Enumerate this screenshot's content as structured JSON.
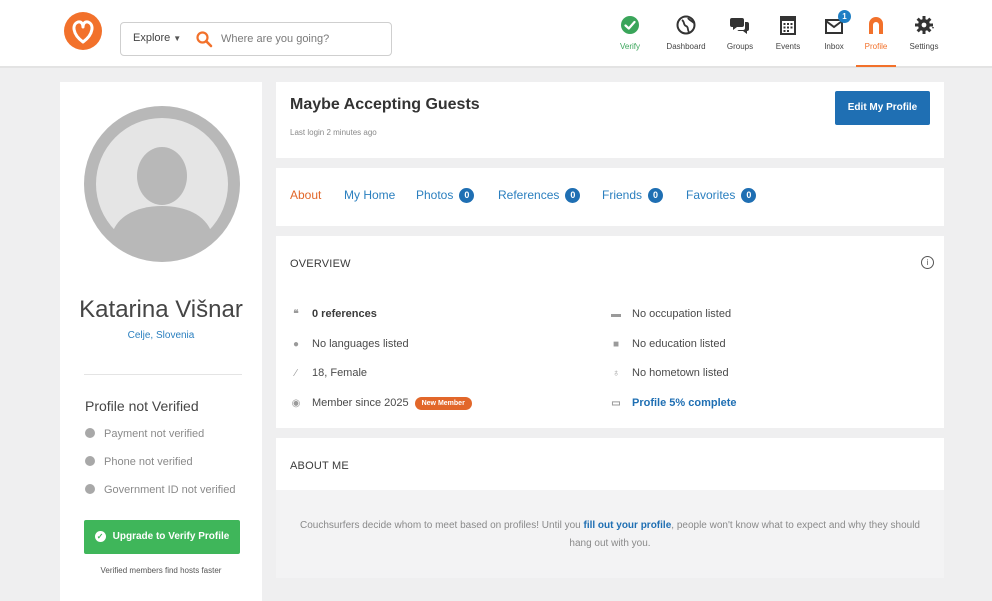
{
  "colors": {
    "brand": "#f2712b",
    "link": "#1f6fb3",
    "verify_green": "#3fb65a",
    "active_tab": "#e2672a"
  },
  "header": {
    "explore_label": "Explore",
    "search_placeholder": "Where are you going?",
    "nav": [
      {
        "label": "Verify",
        "icon": "check-circle-icon"
      },
      {
        "label": "Dashboard",
        "icon": "globe-icon"
      },
      {
        "label": "Groups",
        "icon": "chat-bubbles-icon"
      },
      {
        "label": "Events",
        "icon": "calendar-icon"
      },
      {
        "label": "Inbox",
        "icon": "inbox-icon",
        "badge": "1"
      },
      {
        "label": "Profile",
        "icon": "profile-icon"
      },
      {
        "label": "Settings",
        "icon": "gear-icon"
      }
    ]
  },
  "sidebar": {
    "name": "Katarina Višnar",
    "location": "Celje, Slovenia",
    "verification_heading": "Profile not Verified",
    "verification_items": [
      "Payment not verified",
      "Phone not verified",
      "Government ID not verified"
    ],
    "upgrade_button": "Upgrade to Verify Profile",
    "note": "Verified members find hosts faster"
  },
  "profile": {
    "status": "Maybe Accepting Guests",
    "last_login": "Last login 2 minutes ago",
    "edit_button": "Edit My Profile"
  },
  "tabs": [
    {
      "label": "About",
      "active": true
    },
    {
      "label": "My Home"
    },
    {
      "label": "Photos",
      "count": "0"
    },
    {
      "label": "References",
      "count": "0"
    },
    {
      "label": "Friends",
      "count": "0"
    },
    {
      "label": "Favorites",
      "count": "0"
    }
  ],
  "overview": {
    "heading": "OVERVIEW",
    "info_icon": "i",
    "left": [
      {
        "icon": "quote-icon",
        "text": "0 references"
      },
      {
        "icon": "speech-bubble-icon",
        "text": "No languages listed"
      },
      {
        "icon": "feather-icon",
        "text": "18, Female"
      },
      {
        "icon": "member-icon",
        "text": "Member since 2025",
        "badge": "New Member"
      }
    ],
    "right": [
      {
        "icon": "briefcase-icon",
        "text": "No occupation listed"
      },
      {
        "icon": "book-icon",
        "text": "No education listed"
      },
      {
        "icon": "map-pin-icon",
        "text": "No hometown listed"
      },
      {
        "icon": "id-card-icon",
        "text": "Profile 5% complete"
      }
    ]
  },
  "about_me": {
    "heading": "ABOUT ME",
    "text_before": "Couchsurfers decide whom to meet based on profiles! Until you ",
    "link_text": "fill out your profile",
    "text_after": ", people won't know what to expect and why they should hang out with you."
  }
}
